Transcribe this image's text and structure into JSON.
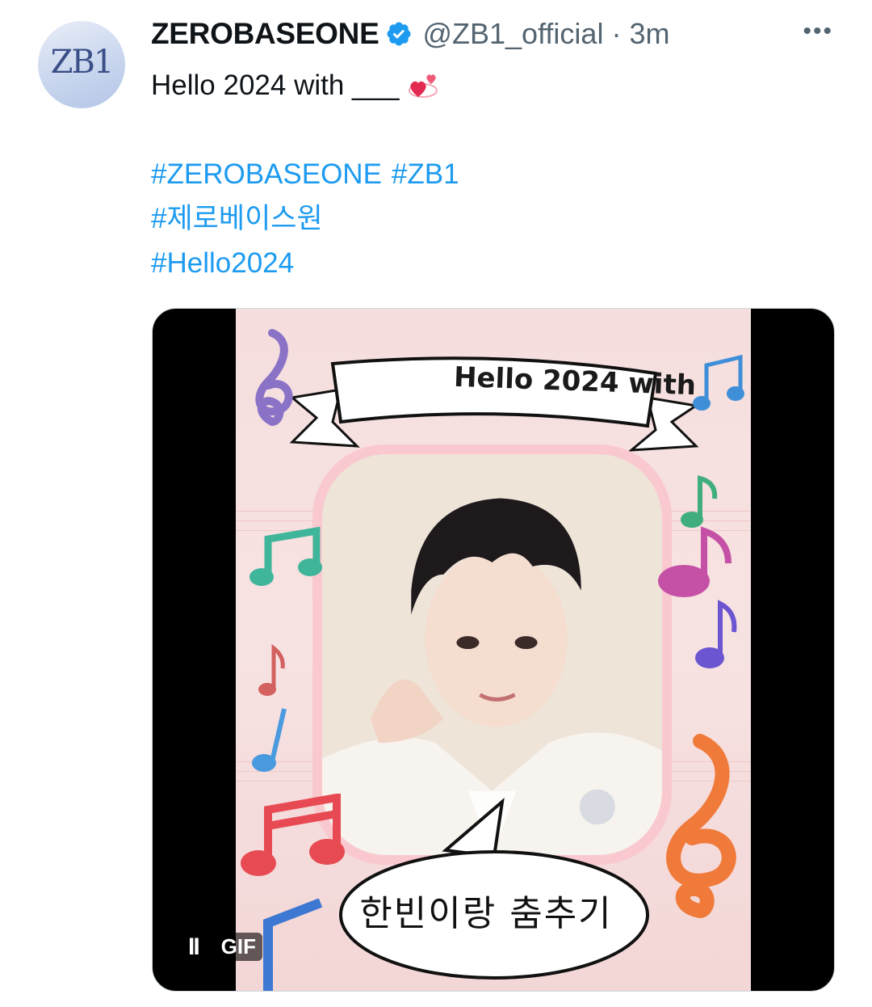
{
  "author": {
    "avatar_text": "ZB1",
    "name": "ZEROBASEONE",
    "handle": "@ZB1_official",
    "separator": "·",
    "time": "3m"
  },
  "more_label": "•••",
  "tweet": {
    "text_line": "Hello 2024 with ___",
    "emoji": "revolving-hearts-emoji",
    "hashtags": {
      "line1_a": "#ZEROBASEONE",
      "line1_b": "#ZB1",
      "line2": "#제로베이스원",
      "line3": "#Hello2024"
    }
  },
  "media": {
    "banner_text": "Hello 2024 with",
    "bubble_text": "한빈이랑 춤추기",
    "pause_label": "II",
    "gif_label": "GIF"
  },
  "colors": {
    "link": "#1d9bf0",
    "secondary_text": "#536471",
    "verified": "#1d9bf0",
    "card_background": "#f6dede"
  }
}
